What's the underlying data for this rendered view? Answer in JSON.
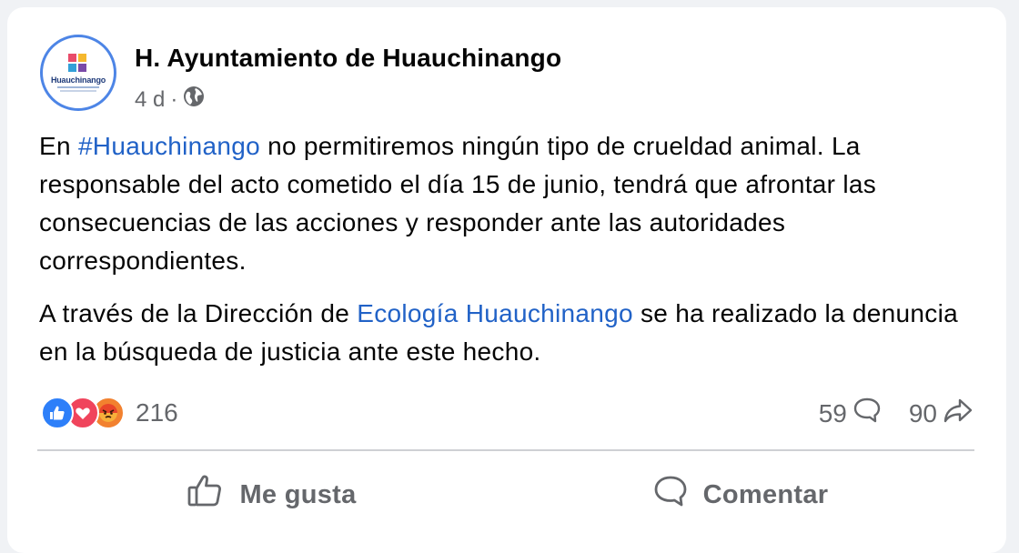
{
  "post": {
    "page_name": "H. Ayuntamiento de Huauchinango",
    "avatar_text": "Huauchinango",
    "time": "4 d",
    "separator": "·",
    "audience_icon": "globe-icon",
    "paragraph1": {
      "prefix": "En ",
      "hashtag": "#Huauchinango",
      "text": " no permitiremos ningún tipo de crueldad animal. La responsable del acto cometido el día 15 de junio, tendrá que afrontar las consecuencias de las acciones y responder ante las autoridades correspondientes."
    },
    "paragraph2": {
      "prefix": "A través de la Dirección de ",
      "mention": "Ecología Huauchinango",
      "text": " se ha realizado la denuncia en la búsqueda de justicia ante este hecho."
    }
  },
  "engagement": {
    "reactions": [
      "like-icon",
      "love-icon",
      "angry-icon"
    ],
    "reaction_count": "216",
    "comments": "59",
    "shares": "90"
  },
  "actions": {
    "like_label": "Me gusta",
    "comment_label": "Comentar"
  },
  "colors": {
    "link": "#2162c7",
    "secondary_text": "#65676b",
    "like": "#2d7ff9",
    "love": "#f0445c",
    "angry": "#f2812f",
    "avatar_ring": "#4d85e6"
  }
}
